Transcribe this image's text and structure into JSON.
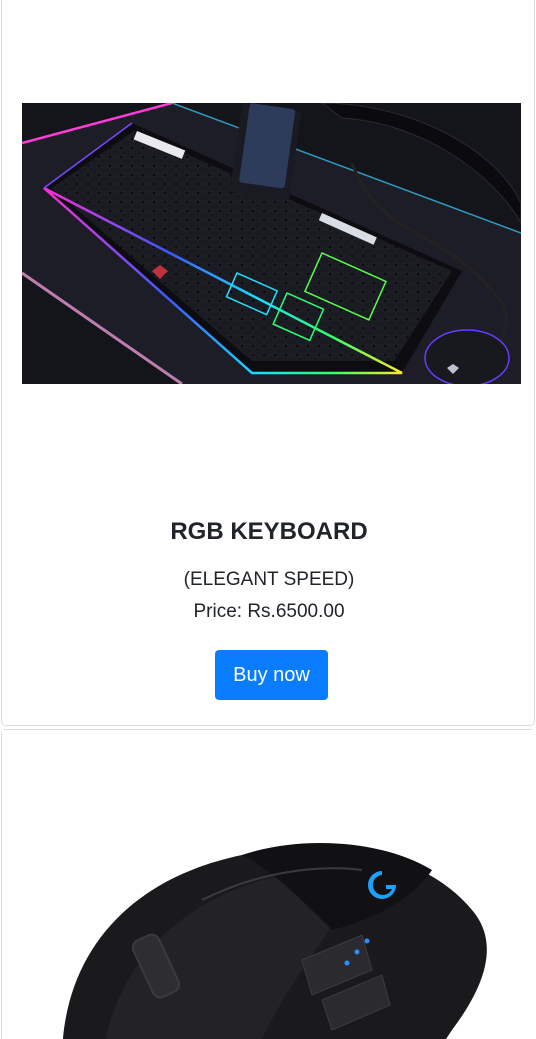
{
  "products": [
    {
      "title": "RGB KEYBOARD",
      "subtitle": "(ELEGANT SPEED)",
      "price": "Price: Rs.6500.00",
      "button_label": "Buy now",
      "image_alt": "keyboard-photo"
    },
    {
      "image_alt": "mouse-photo"
    }
  ],
  "colors": {
    "button_bg": "#0a7cff",
    "text": "#212529",
    "card_border": "#dcdcdc"
  }
}
